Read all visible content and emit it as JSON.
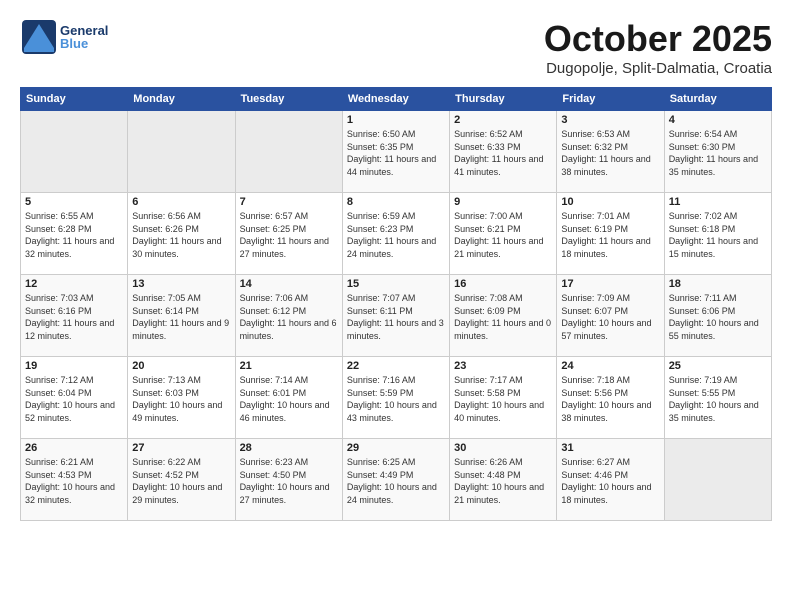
{
  "header": {
    "logo_general": "General",
    "logo_blue": "Blue",
    "month": "October 2025",
    "location": "Dugopolje, Split-Dalmatia, Croatia"
  },
  "weekdays": [
    "Sunday",
    "Monday",
    "Tuesday",
    "Wednesday",
    "Thursday",
    "Friday",
    "Saturday"
  ],
  "weeks": [
    [
      {
        "day": "",
        "empty": true
      },
      {
        "day": "",
        "empty": true
      },
      {
        "day": "",
        "empty": true
      },
      {
        "day": "1",
        "sunrise": "6:50 AM",
        "sunset": "6:35 PM",
        "daylight": "11 hours and 44 minutes."
      },
      {
        "day": "2",
        "sunrise": "6:52 AM",
        "sunset": "6:33 PM",
        "daylight": "11 hours and 41 minutes."
      },
      {
        "day": "3",
        "sunrise": "6:53 AM",
        "sunset": "6:32 PM",
        "daylight": "11 hours and 38 minutes."
      },
      {
        "day": "4",
        "sunrise": "6:54 AM",
        "sunset": "6:30 PM",
        "daylight": "11 hours and 35 minutes."
      }
    ],
    [
      {
        "day": "5",
        "sunrise": "6:55 AM",
        "sunset": "6:28 PM",
        "daylight": "11 hours and 32 minutes."
      },
      {
        "day": "6",
        "sunrise": "6:56 AM",
        "sunset": "6:26 PM",
        "daylight": "11 hours and 30 minutes."
      },
      {
        "day": "7",
        "sunrise": "6:57 AM",
        "sunset": "6:25 PM",
        "daylight": "11 hours and 27 minutes."
      },
      {
        "day": "8",
        "sunrise": "6:59 AM",
        "sunset": "6:23 PM",
        "daylight": "11 hours and 24 minutes."
      },
      {
        "day": "9",
        "sunrise": "7:00 AM",
        "sunset": "6:21 PM",
        "daylight": "11 hours and 21 minutes."
      },
      {
        "day": "10",
        "sunrise": "7:01 AM",
        "sunset": "6:19 PM",
        "daylight": "11 hours and 18 minutes."
      },
      {
        "day": "11",
        "sunrise": "7:02 AM",
        "sunset": "6:18 PM",
        "daylight": "11 hours and 15 minutes."
      }
    ],
    [
      {
        "day": "12",
        "sunrise": "7:03 AM",
        "sunset": "6:16 PM",
        "daylight": "11 hours and 12 minutes."
      },
      {
        "day": "13",
        "sunrise": "7:05 AM",
        "sunset": "6:14 PM",
        "daylight": "11 hours and 9 minutes."
      },
      {
        "day": "14",
        "sunrise": "7:06 AM",
        "sunset": "6:12 PM",
        "daylight": "11 hours and 6 minutes."
      },
      {
        "day": "15",
        "sunrise": "7:07 AM",
        "sunset": "6:11 PM",
        "daylight": "11 hours and 3 minutes."
      },
      {
        "day": "16",
        "sunrise": "7:08 AM",
        "sunset": "6:09 PM",
        "daylight": "11 hours and 0 minutes."
      },
      {
        "day": "17",
        "sunrise": "7:09 AM",
        "sunset": "6:07 PM",
        "daylight": "10 hours and 57 minutes."
      },
      {
        "day": "18",
        "sunrise": "7:11 AM",
        "sunset": "6:06 PM",
        "daylight": "10 hours and 55 minutes."
      }
    ],
    [
      {
        "day": "19",
        "sunrise": "7:12 AM",
        "sunset": "6:04 PM",
        "daylight": "10 hours and 52 minutes."
      },
      {
        "day": "20",
        "sunrise": "7:13 AM",
        "sunset": "6:03 PM",
        "daylight": "10 hours and 49 minutes."
      },
      {
        "day": "21",
        "sunrise": "7:14 AM",
        "sunset": "6:01 PM",
        "daylight": "10 hours and 46 minutes."
      },
      {
        "day": "22",
        "sunrise": "7:16 AM",
        "sunset": "5:59 PM",
        "daylight": "10 hours and 43 minutes."
      },
      {
        "day": "23",
        "sunrise": "7:17 AM",
        "sunset": "5:58 PM",
        "daylight": "10 hours and 40 minutes."
      },
      {
        "day": "24",
        "sunrise": "7:18 AM",
        "sunset": "5:56 PM",
        "daylight": "10 hours and 38 minutes."
      },
      {
        "day": "25",
        "sunrise": "7:19 AM",
        "sunset": "5:55 PM",
        "daylight": "10 hours and 35 minutes."
      }
    ],
    [
      {
        "day": "26",
        "sunrise": "6:21 AM",
        "sunset": "4:53 PM",
        "daylight": "10 hours and 32 minutes."
      },
      {
        "day": "27",
        "sunrise": "6:22 AM",
        "sunset": "4:52 PM",
        "daylight": "10 hours and 29 minutes."
      },
      {
        "day": "28",
        "sunrise": "6:23 AM",
        "sunset": "4:50 PM",
        "daylight": "10 hours and 27 minutes."
      },
      {
        "day": "29",
        "sunrise": "6:25 AM",
        "sunset": "4:49 PM",
        "daylight": "10 hours and 24 minutes."
      },
      {
        "day": "30",
        "sunrise": "6:26 AM",
        "sunset": "4:48 PM",
        "daylight": "10 hours and 21 minutes."
      },
      {
        "day": "31",
        "sunrise": "6:27 AM",
        "sunset": "4:46 PM",
        "daylight": "10 hours and 18 minutes."
      },
      {
        "day": "",
        "empty": true
      }
    ]
  ]
}
